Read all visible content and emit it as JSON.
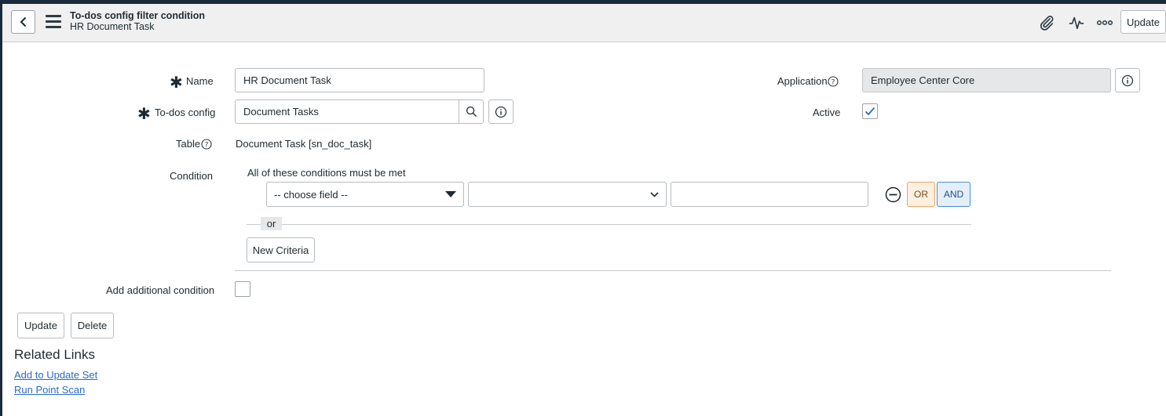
{
  "header": {
    "title": "To-dos config filter condition",
    "subtitle": "HR Document Task",
    "update_label": "Update"
  },
  "form": {
    "name": {
      "label": "Name",
      "value": "HR Document Task"
    },
    "todos_config": {
      "label": "To-dos config",
      "value": "Document Tasks"
    },
    "table": {
      "label": "Table",
      "value": "Document Task [sn_doc_task]"
    },
    "application": {
      "label": "Application",
      "value": "Employee Center Core"
    },
    "active": {
      "label": "Active",
      "checked": true
    },
    "condition": {
      "label": "Condition",
      "heading": "All of these conditions must be met",
      "field_placeholder": "-- choose field --",
      "operator_value": "",
      "value": "",
      "or_button": "OR",
      "and_button": "AND",
      "or_separator": "or",
      "new_criteria": "New Criteria"
    },
    "additional_condition": {
      "label": "Add additional condition",
      "checked": false
    }
  },
  "actions": {
    "update": "Update",
    "delete": "Delete"
  },
  "related_links": {
    "title": "Related Links",
    "items": [
      "Add to Update Set",
      "Run Point Scan"
    ]
  },
  "colors": {
    "or_bg": "#fdf0e0",
    "or_border": "#e8a66a",
    "and_bg": "#e4effb",
    "and_border": "#4a8fd6",
    "link": "#2b6cc4",
    "check": "#2b6cc4"
  }
}
